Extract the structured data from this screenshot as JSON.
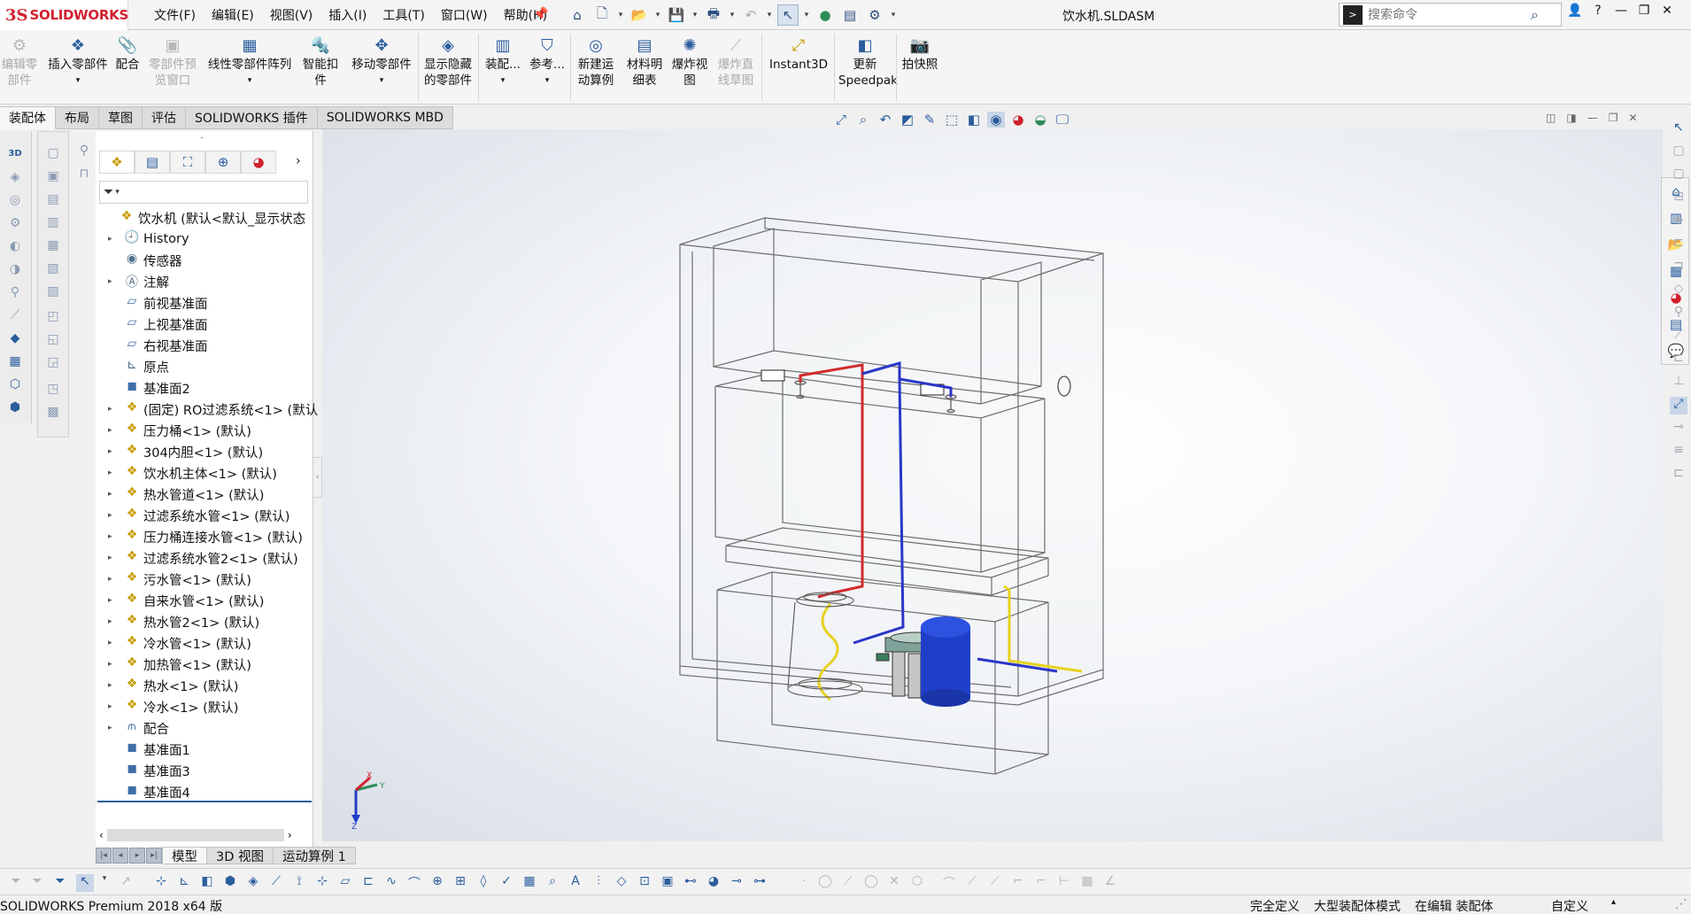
{
  "app": {
    "brand": "SOLIDWORKS",
    "document_title": "饮水机.SLDASM"
  },
  "menus": [
    "文件(F)",
    "编辑(E)",
    "视图(V)",
    "插入(I)",
    "工具(T)",
    "窗口(W)",
    "帮助(H)"
  ],
  "search": {
    "placeholder": "搜索命令"
  },
  "ribbon": {
    "edit_component": "编辑零部件",
    "insert_components": "插入零部件",
    "mate": "配合",
    "component_preview": "零部件预览窗口",
    "linear_pattern": "线性零部件阵列",
    "smart_fasteners": "智能扣件",
    "move_component": "移动零部件",
    "show_hidden": "显示隐藏的零部件",
    "assembly_features": "装配...",
    "reference_geometry": "参考...",
    "new_motion_study": "新建运动算例",
    "bom": "材料明细表",
    "exploded_view": "爆炸视图",
    "explode_line": "爆炸直线草图",
    "instant3d": "Instant3D",
    "update_speedpak": "更新Speedpak",
    "snapshot": "拍快照"
  },
  "tabs": [
    "装配体",
    "布局",
    "草图",
    "评估",
    "SOLIDWORKS 插件",
    "SOLIDWORKS MBD"
  ],
  "feature_tree": {
    "nodes": [
      {
        "label": "饮水机 (默认<默认_显示状态",
        "icon": "assembly-icon",
        "expand": false
      },
      {
        "label": "History",
        "icon": "history-icon",
        "expand": true
      },
      {
        "label": "传感器",
        "icon": "sensor-icon",
        "expand": false
      },
      {
        "label": "注解",
        "icon": "annotation-icon",
        "expand": true
      },
      {
        "label": "前视基准面",
        "icon": "plane-icon",
        "expand": false
      },
      {
        "label": "上视基准面",
        "icon": "plane-icon",
        "expand": false
      },
      {
        "label": "右视基准面",
        "icon": "plane-icon",
        "expand": false
      },
      {
        "label": "原点",
        "icon": "origin-icon",
        "expand": false
      },
      {
        "label": "基准面2",
        "icon": "plane-icon",
        "expand": false
      },
      {
        "label": "(固定) RO过滤系统<1> (默认",
        "icon": "subassembly-icon",
        "expand": true
      },
      {
        "label": "压力桶<1> (默认)",
        "icon": "subassembly-icon",
        "expand": true
      },
      {
        "label": "304内胆<1> (默认)",
        "icon": "subassembly-icon",
        "expand": true
      },
      {
        "label": "饮水机主体<1> (默认)",
        "icon": "subassembly-icon",
        "expand": true
      },
      {
        "label": "热水管道<1> (默认)",
        "icon": "subassembly-icon",
        "expand": true
      },
      {
        "label": "过滤系统水管<1> (默认)",
        "icon": "subassembly-icon",
        "expand": true
      },
      {
        "label": "压力桶连接水管<1> (默认)",
        "icon": "subassembly-icon",
        "expand": true
      },
      {
        "label": "过滤系统水管2<1> (默认)",
        "icon": "subassembly-icon",
        "expand": true
      },
      {
        "label": "污水管<1> (默认)",
        "icon": "subassembly-icon",
        "expand": true
      },
      {
        "label": "自来水管<1> (默认)",
        "icon": "subassembly-icon",
        "expand": true
      },
      {
        "label": "热水管2<1> (默认)",
        "icon": "subassembly-icon",
        "expand": true
      },
      {
        "label": "冷水管<1> (默认)",
        "icon": "subassembly-icon",
        "expand": true
      },
      {
        "label": "加热管<1> (默认)",
        "icon": "subassembly-icon",
        "expand": true
      },
      {
        "label": "热水<1> (默认)",
        "icon": "subassembly-icon",
        "expand": true
      },
      {
        "label": "冷水<1> (默认)",
        "icon": "subassembly-icon",
        "expand": true
      },
      {
        "label": "配合",
        "icon": "mates-icon",
        "expand": true
      },
      {
        "label": "基准面1",
        "icon": "plane-icon",
        "expand": false
      },
      {
        "label": "基准面3",
        "icon": "plane-icon",
        "expand": false
      },
      {
        "label": "基准面4",
        "icon": "plane-icon",
        "expand": false
      }
    ]
  },
  "model_tabs": [
    "模型",
    "3D 视图",
    "运动算例 1"
  ],
  "triad": {
    "x": "X",
    "y": "Y",
    "z": "Z"
  },
  "status": {
    "product": "SOLIDWORKS Premium 2018 x64 版",
    "definition": "完全定义",
    "mode": "大型装配体模式",
    "editing": "在编辑 装配体",
    "units": "自定义"
  },
  "colors": {
    "brand_red": "#d2202f",
    "accent_blue": "#2b5d9d",
    "hot_pipe": "#d22a2a",
    "cold_pipe": "#2a36c8",
    "yellow_pipe": "#e6d21e",
    "tank_blue": "#1f3fc9"
  }
}
